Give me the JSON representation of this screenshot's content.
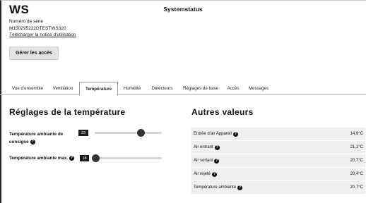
{
  "header": {
    "title": "WS",
    "system_title": "Systemstatus",
    "serial_label": "Numéro de série",
    "serial_value": "M150295222DTESTWS320",
    "manual_link": "Télécharger la notice d'utilisation",
    "access_button": "Gérer les accès"
  },
  "tabs": [
    {
      "label": "Vue d'ensemble",
      "active": false
    },
    {
      "label": "Ventilation",
      "active": false
    },
    {
      "label": "Température",
      "active": true
    },
    {
      "label": "Humidité",
      "active": false
    },
    {
      "label": "Détecteurs",
      "active": false
    },
    {
      "label": "Réglages de base",
      "active": false
    },
    {
      "label": "Accès",
      "active": false
    },
    {
      "label": "Messages",
      "active": false
    }
  ],
  "settings": {
    "heading": "Réglages de la température",
    "items": [
      {
        "label": "Température ambiante de consigne",
        "value": "23",
        "slider_fraction": 0.72
      },
      {
        "label": "Température ambiante max.",
        "value": "18",
        "slider_fraction": 0.0
      }
    ]
  },
  "other_values": {
    "heading": "Autres valeurs",
    "rows": [
      {
        "label": "Entrée d'air Appareil",
        "value": "14,9°C"
      },
      {
        "label": "Air entrant",
        "value": "21,1°C"
      },
      {
        "label": "Air sortant",
        "value": "20,7°C"
      },
      {
        "label": "Air rejeté",
        "value": "20,4°C"
      },
      {
        "label": "Température ambiante",
        "value": "20,7°C"
      }
    ]
  },
  "icons": {
    "help": "question-circle-icon"
  }
}
